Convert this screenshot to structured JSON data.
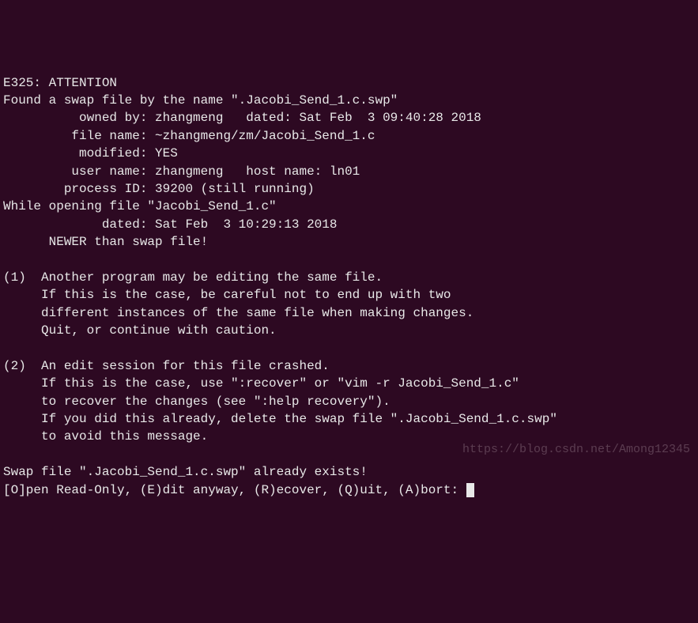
{
  "lines": {
    "l0": "E325: ATTENTION",
    "l1": "Found a swap file by the name \".Jacobi_Send_1.c.swp\"",
    "l2": "          owned by: zhangmeng   dated: Sat Feb  3 09:40:28 2018",
    "l3": "         file name: ~zhangmeng/zm/Jacobi_Send_1.c",
    "l4": "          modified: YES",
    "l5": "         user name: zhangmeng   host name: ln01",
    "l6": "        process ID: 39200 (still running)",
    "l7": "While opening file \"Jacobi_Send_1.c\"",
    "l8": "             dated: Sat Feb  3 10:29:13 2018",
    "l9": "      NEWER than swap file!",
    "l10": "",
    "l11": "(1)  Another program may be editing the same file.",
    "l12": "     If this is the case, be careful not to end up with two",
    "l13": "     different instances of the same file when making changes.",
    "l14": "     Quit, or continue with caution.",
    "l15": "",
    "l16": "(2)  An edit session for this file crashed.",
    "l17": "     If this is the case, use \":recover\" or \"vim -r Jacobi_Send_1.c\"",
    "l18": "     to recover the changes (see \":help recovery\").",
    "l19": "     If you did this already, delete the swap file \".Jacobi_Send_1.c.swp\"",
    "l20": "     to avoid this message.",
    "l21": "",
    "l22": "Swap file \".Jacobi_Send_1.c.swp\" already exists!",
    "l23": "[O]pen Read-Only, (E)dit anyway, (R)ecover, (Q)uit, (A)bort: "
  },
  "watermark": "https://blog.csdn.net/Among12345"
}
